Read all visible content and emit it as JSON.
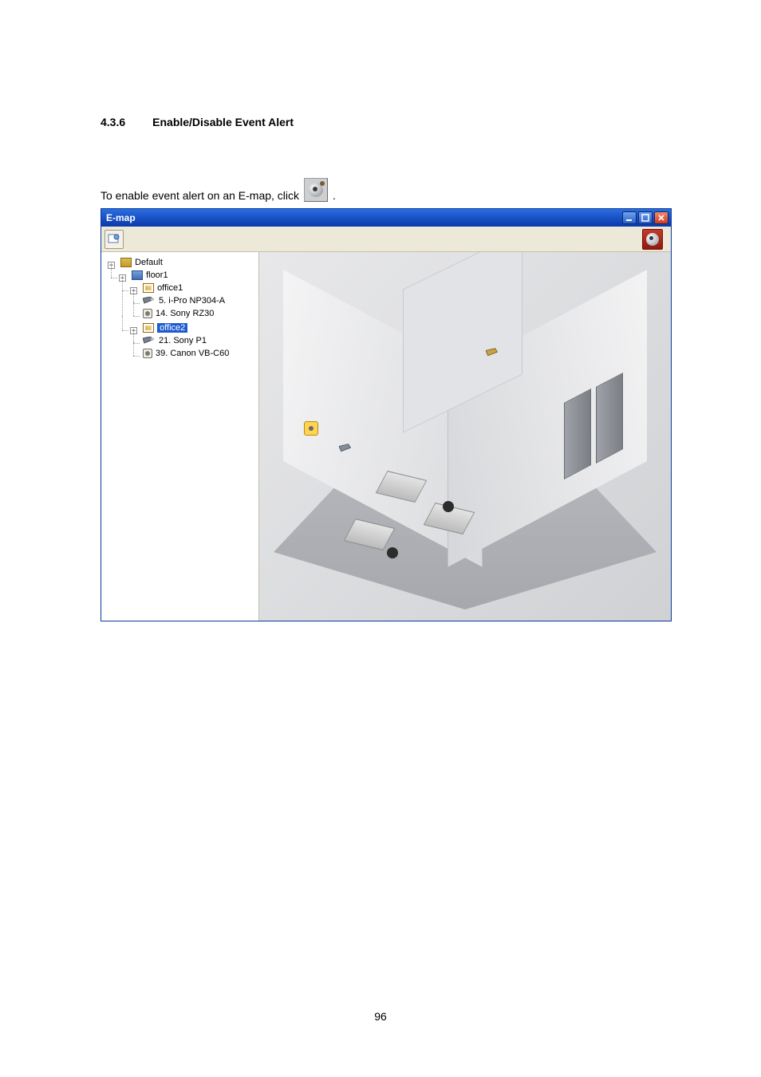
{
  "heading": {
    "num": "4.3.6",
    "title": "Enable/Disable Event Alert"
  },
  "body": {
    "prefix": "To enable event alert on an E-map, click",
    "suffix": "."
  },
  "window": {
    "title": "E-map",
    "toolbar": {
      "map_edit_icon": "map-edit-icon",
      "alert_icon": "event-alert-toggle-icon"
    },
    "tree": {
      "root": "Default",
      "floor": "floor1",
      "office1": {
        "label": "office1",
        "cam1": "5. i-Pro NP304-A",
        "cam2": "14. Sony RZ30"
      },
      "office2": {
        "label": "office2",
        "cam1": "21. Sony P1",
        "cam2": "39. Canon VB-C60"
      }
    }
  },
  "page_number": "96"
}
